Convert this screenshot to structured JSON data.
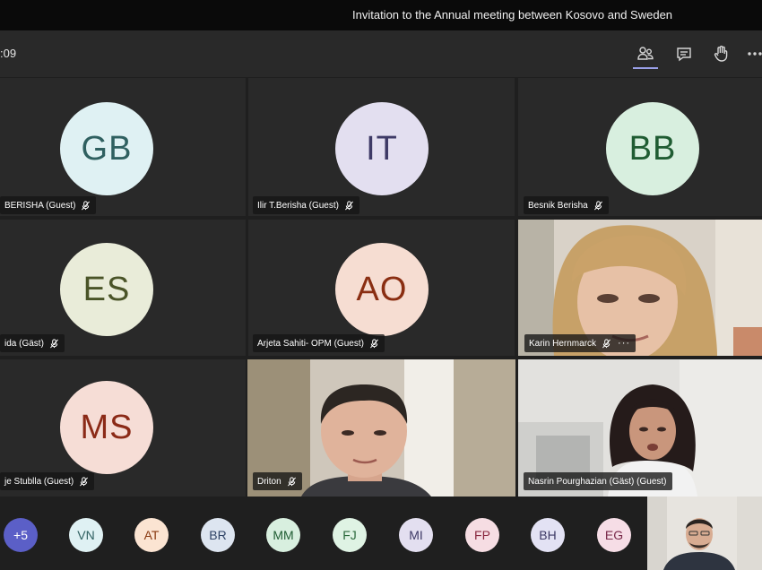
{
  "window": {
    "title": "Invitation to the Annual meeting between Kosovo and Sweden"
  },
  "toolbar": {
    "timer": ":09",
    "icons": [
      "participants-icon",
      "chat-icon",
      "raise-hand-icon",
      "more-options-icon"
    ]
  },
  "tiles": [
    {
      "initials": "GB",
      "name": "BERISHA (Guest)",
      "avatar_bg": "#dff1f3",
      "avatar_fg": "#2f6060"
    },
    {
      "initials": "IT",
      "name": "Ilir T.Berisha (Guest)",
      "avatar_bg": "#e3dff0",
      "avatar_fg": "#3e3a66"
    },
    {
      "initials": "BB",
      "name": "Besnik Berisha",
      "avatar_bg": "#d8efdf",
      "avatar_fg": "#1f5c32"
    },
    {
      "initials": "ES",
      "name": "ida (Gäst)",
      "avatar_bg": "#e9ecd9",
      "avatar_fg": "#4a5428"
    },
    {
      "initials": "AO",
      "name": "Arjeta Sahiti- OPM (Guest)",
      "avatar_bg": "#f6ddd2",
      "avatar_fg": "#8a2e12"
    },
    {
      "name": "Karin Hernmarck",
      "has_video": true,
      "has_more": true,
      "more_label": "···"
    },
    {
      "initials": "MS",
      "name": "je Stublla (Guest)",
      "avatar_bg": "#f6ddd6",
      "avatar_fg": "#8b2a17"
    },
    {
      "name": "Driton",
      "has_video": true
    },
    {
      "name": "Nasrin Pourghazian (Gäst) (Guest)",
      "has_video": true
    }
  ],
  "strip": [
    {
      "label": "+5",
      "bg": "#5b5fc7",
      "fg": "#ffffff"
    },
    {
      "label": "VN",
      "bg": "#dff1f3",
      "fg": "#2f6060"
    },
    {
      "label": "AT",
      "bg": "#fbe4d2",
      "fg": "#8a3a12"
    },
    {
      "label": "BR",
      "bg": "#dde5f0",
      "fg": "#2f4466"
    },
    {
      "label": "MM",
      "bg": "#d8efdf",
      "fg": "#1f5c32"
    },
    {
      "label": "FJ",
      "bg": "#dff3e4",
      "fg": "#2c6a3c"
    },
    {
      "label": "MI",
      "bg": "#e3dff0",
      "fg": "#3e3a66"
    },
    {
      "label": "FP",
      "bg": "#f6dde3",
      "fg": "#8a2a40"
    },
    {
      "label": "BH",
      "bg": "#e3e2f4",
      "fg": "#3e3a66"
    },
    {
      "label": "EG",
      "bg": "#f6dde6",
      "fg": "#7a2a4a"
    }
  ]
}
